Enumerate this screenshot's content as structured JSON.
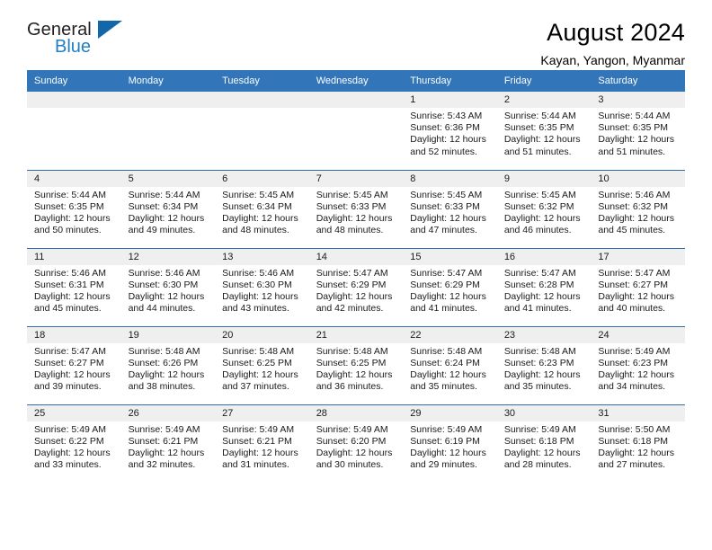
{
  "brand": {
    "name_part1": "General",
    "name_part2": "Blue",
    "logo_icon": "triangle-logo-icon"
  },
  "header": {
    "month_title": "August 2024",
    "location": "Kayan, Yangon, Myanmar"
  },
  "colors": {
    "header_blue": "#3275b8",
    "row_divider": "#2f6fae",
    "daynum_band": "#efefef",
    "brand_blue": "#1f7ec4",
    "brand_triangle": "#1366a8"
  },
  "weekday_headers": [
    "Sunday",
    "Monday",
    "Tuesday",
    "Wednesday",
    "Thursday",
    "Friday",
    "Saturday"
  ],
  "weeks": [
    [
      {
        "day": "",
        "empty": true,
        "sunrise": "",
        "sunset": "",
        "daylight_line1": "",
        "daylight_line2": ""
      },
      {
        "day": "",
        "empty": true,
        "sunrise": "",
        "sunset": "",
        "daylight_line1": "",
        "daylight_line2": ""
      },
      {
        "day": "",
        "empty": true,
        "sunrise": "",
        "sunset": "",
        "daylight_line1": "",
        "daylight_line2": ""
      },
      {
        "day": "",
        "empty": true,
        "sunrise": "",
        "sunset": "",
        "daylight_line1": "",
        "daylight_line2": ""
      },
      {
        "day": "1",
        "empty": false,
        "sunrise": "Sunrise: 5:43 AM",
        "sunset": "Sunset: 6:36 PM",
        "daylight_line1": "Daylight: 12 hours",
        "daylight_line2": "and 52 minutes."
      },
      {
        "day": "2",
        "empty": false,
        "sunrise": "Sunrise: 5:44 AM",
        "sunset": "Sunset: 6:35 PM",
        "daylight_line1": "Daylight: 12 hours",
        "daylight_line2": "and 51 minutes."
      },
      {
        "day": "3",
        "empty": false,
        "sunrise": "Sunrise: 5:44 AM",
        "sunset": "Sunset: 6:35 PM",
        "daylight_line1": "Daylight: 12 hours",
        "daylight_line2": "and 51 minutes."
      }
    ],
    [
      {
        "day": "4",
        "empty": false,
        "sunrise": "Sunrise: 5:44 AM",
        "sunset": "Sunset: 6:35 PM",
        "daylight_line1": "Daylight: 12 hours",
        "daylight_line2": "and 50 minutes."
      },
      {
        "day": "5",
        "empty": false,
        "sunrise": "Sunrise: 5:44 AM",
        "sunset": "Sunset: 6:34 PM",
        "daylight_line1": "Daylight: 12 hours",
        "daylight_line2": "and 49 minutes."
      },
      {
        "day": "6",
        "empty": false,
        "sunrise": "Sunrise: 5:45 AM",
        "sunset": "Sunset: 6:34 PM",
        "daylight_line1": "Daylight: 12 hours",
        "daylight_line2": "and 48 minutes."
      },
      {
        "day": "7",
        "empty": false,
        "sunrise": "Sunrise: 5:45 AM",
        "sunset": "Sunset: 6:33 PM",
        "daylight_line1": "Daylight: 12 hours",
        "daylight_line2": "and 48 minutes."
      },
      {
        "day": "8",
        "empty": false,
        "sunrise": "Sunrise: 5:45 AM",
        "sunset": "Sunset: 6:33 PM",
        "daylight_line1": "Daylight: 12 hours",
        "daylight_line2": "and 47 minutes."
      },
      {
        "day": "9",
        "empty": false,
        "sunrise": "Sunrise: 5:45 AM",
        "sunset": "Sunset: 6:32 PM",
        "daylight_line1": "Daylight: 12 hours",
        "daylight_line2": "and 46 minutes."
      },
      {
        "day": "10",
        "empty": false,
        "sunrise": "Sunrise: 5:46 AM",
        "sunset": "Sunset: 6:32 PM",
        "daylight_line1": "Daylight: 12 hours",
        "daylight_line2": "and 45 minutes."
      }
    ],
    [
      {
        "day": "11",
        "empty": false,
        "sunrise": "Sunrise: 5:46 AM",
        "sunset": "Sunset: 6:31 PM",
        "daylight_line1": "Daylight: 12 hours",
        "daylight_line2": "and 45 minutes."
      },
      {
        "day": "12",
        "empty": false,
        "sunrise": "Sunrise: 5:46 AM",
        "sunset": "Sunset: 6:30 PM",
        "daylight_line1": "Daylight: 12 hours",
        "daylight_line2": "and 44 minutes."
      },
      {
        "day": "13",
        "empty": false,
        "sunrise": "Sunrise: 5:46 AM",
        "sunset": "Sunset: 6:30 PM",
        "daylight_line1": "Daylight: 12 hours",
        "daylight_line2": "and 43 minutes."
      },
      {
        "day": "14",
        "empty": false,
        "sunrise": "Sunrise: 5:47 AM",
        "sunset": "Sunset: 6:29 PM",
        "daylight_line1": "Daylight: 12 hours",
        "daylight_line2": "and 42 minutes."
      },
      {
        "day": "15",
        "empty": false,
        "sunrise": "Sunrise: 5:47 AM",
        "sunset": "Sunset: 6:29 PM",
        "daylight_line1": "Daylight: 12 hours",
        "daylight_line2": "and 41 minutes."
      },
      {
        "day": "16",
        "empty": false,
        "sunrise": "Sunrise: 5:47 AM",
        "sunset": "Sunset: 6:28 PM",
        "daylight_line1": "Daylight: 12 hours",
        "daylight_line2": "and 41 minutes."
      },
      {
        "day": "17",
        "empty": false,
        "sunrise": "Sunrise: 5:47 AM",
        "sunset": "Sunset: 6:27 PM",
        "daylight_line1": "Daylight: 12 hours",
        "daylight_line2": "and 40 minutes."
      }
    ],
    [
      {
        "day": "18",
        "empty": false,
        "sunrise": "Sunrise: 5:47 AM",
        "sunset": "Sunset: 6:27 PM",
        "daylight_line1": "Daylight: 12 hours",
        "daylight_line2": "and 39 minutes."
      },
      {
        "day": "19",
        "empty": false,
        "sunrise": "Sunrise: 5:48 AM",
        "sunset": "Sunset: 6:26 PM",
        "daylight_line1": "Daylight: 12 hours",
        "daylight_line2": "and 38 minutes."
      },
      {
        "day": "20",
        "empty": false,
        "sunrise": "Sunrise: 5:48 AM",
        "sunset": "Sunset: 6:25 PM",
        "daylight_line1": "Daylight: 12 hours",
        "daylight_line2": "and 37 minutes."
      },
      {
        "day": "21",
        "empty": false,
        "sunrise": "Sunrise: 5:48 AM",
        "sunset": "Sunset: 6:25 PM",
        "daylight_line1": "Daylight: 12 hours",
        "daylight_line2": "and 36 minutes."
      },
      {
        "day": "22",
        "empty": false,
        "sunrise": "Sunrise: 5:48 AM",
        "sunset": "Sunset: 6:24 PM",
        "daylight_line1": "Daylight: 12 hours",
        "daylight_line2": "and 35 minutes."
      },
      {
        "day": "23",
        "empty": false,
        "sunrise": "Sunrise: 5:48 AM",
        "sunset": "Sunset: 6:23 PM",
        "daylight_line1": "Daylight: 12 hours",
        "daylight_line2": "and 35 minutes."
      },
      {
        "day": "24",
        "empty": false,
        "sunrise": "Sunrise: 5:49 AM",
        "sunset": "Sunset: 6:23 PM",
        "daylight_line1": "Daylight: 12 hours",
        "daylight_line2": "and 34 minutes."
      }
    ],
    [
      {
        "day": "25",
        "empty": false,
        "sunrise": "Sunrise: 5:49 AM",
        "sunset": "Sunset: 6:22 PM",
        "daylight_line1": "Daylight: 12 hours",
        "daylight_line2": "and 33 minutes."
      },
      {
        "day": "26",
        "empty": false,
        "sunrise": "Sunrise: 5:49 AM",
        "sunset": "Sunset: 6:21 PM",
        "daylight_line1": "Daylight: 12 hours",
        "daylight_line2": "and 32 minutes."
      },
      {
        "day": "27",
        "empty": false,
        "sunrise": "Sunrise: 5:49 AM",
        "sunset": "Sunset: 6:21 PM",
        "daylight_line1": "Daylight: 12 hours",
        "daylight_line2": "and 31 minutes."
      },
      {
        "day": "28",
        "empty": false,
        "sunrise": "Sunrise: 5:49 AM",
        "sunset": "Sunset: 6:20 PM",
        "daylight_line1": "Daylight: 12 hours",
        "daylight_line2": "and 30 minutes."
      },
      {
        "day": "29",
        "empty": false,
        "sunrise": "Sunrise: 5:49 AM",
        "sunset": "Sunset: 6:19 PM",
        "daylight_line1": "Daylight: 12 hours",
        "daylight_line2": "and 29 minutes."
      },
      {
        "day": "30",
        "empty": false,
        "sunrise": "Sunrise: 5:49 AM",
        "sunset": "Sunset: 6:18 PM",
        "daylight_line1": "Daylight: 12 hours",
        "daylight_line2": "and 28 minutes."
      },
      {
        "day": "31",
        "empty": false,
        "sunrise": "Sunrise: 5:50 AM",
        "sunset": "Sunset: 6:18 PM",
        "daylight_line1": "Daylight: 12 hours",
        "daylight_line2": "and 27 minutes."
      }
    ]
  ]
}
